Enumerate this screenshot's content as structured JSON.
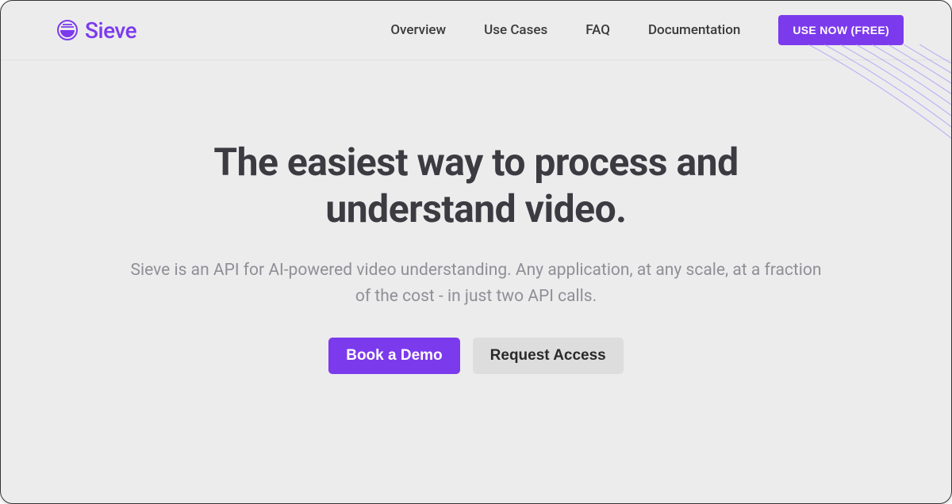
{
  "brand": {
    "name": "Sieve"
  },
  "nav": {
    "items": [
      {
        "label": "Overview"
      },
      {
        "label": "Use Cases"
      },
      {
        "label": "FAQ"
      },
      {
        "label": "Documentation"
      }
    ],
    "cta": "USE NOW (FREE)"
  },
  "hero": {
    "title": "The easiest way to process and understand video.",
    "subtitle": "Sieve is an API for AI-powered video understanding. Any application, at any scale, at a fraction of the cost - in just two API calls.",
    "primary_button": "Book a Demo",
    "secondary_button": "Request Access"
  },
  "colors": {
    "accent": "#7c3aed",
    "background": "#ececed",
    "heading": "#3b3b41",
    "subtext": "#8f8f96"
  }
}
